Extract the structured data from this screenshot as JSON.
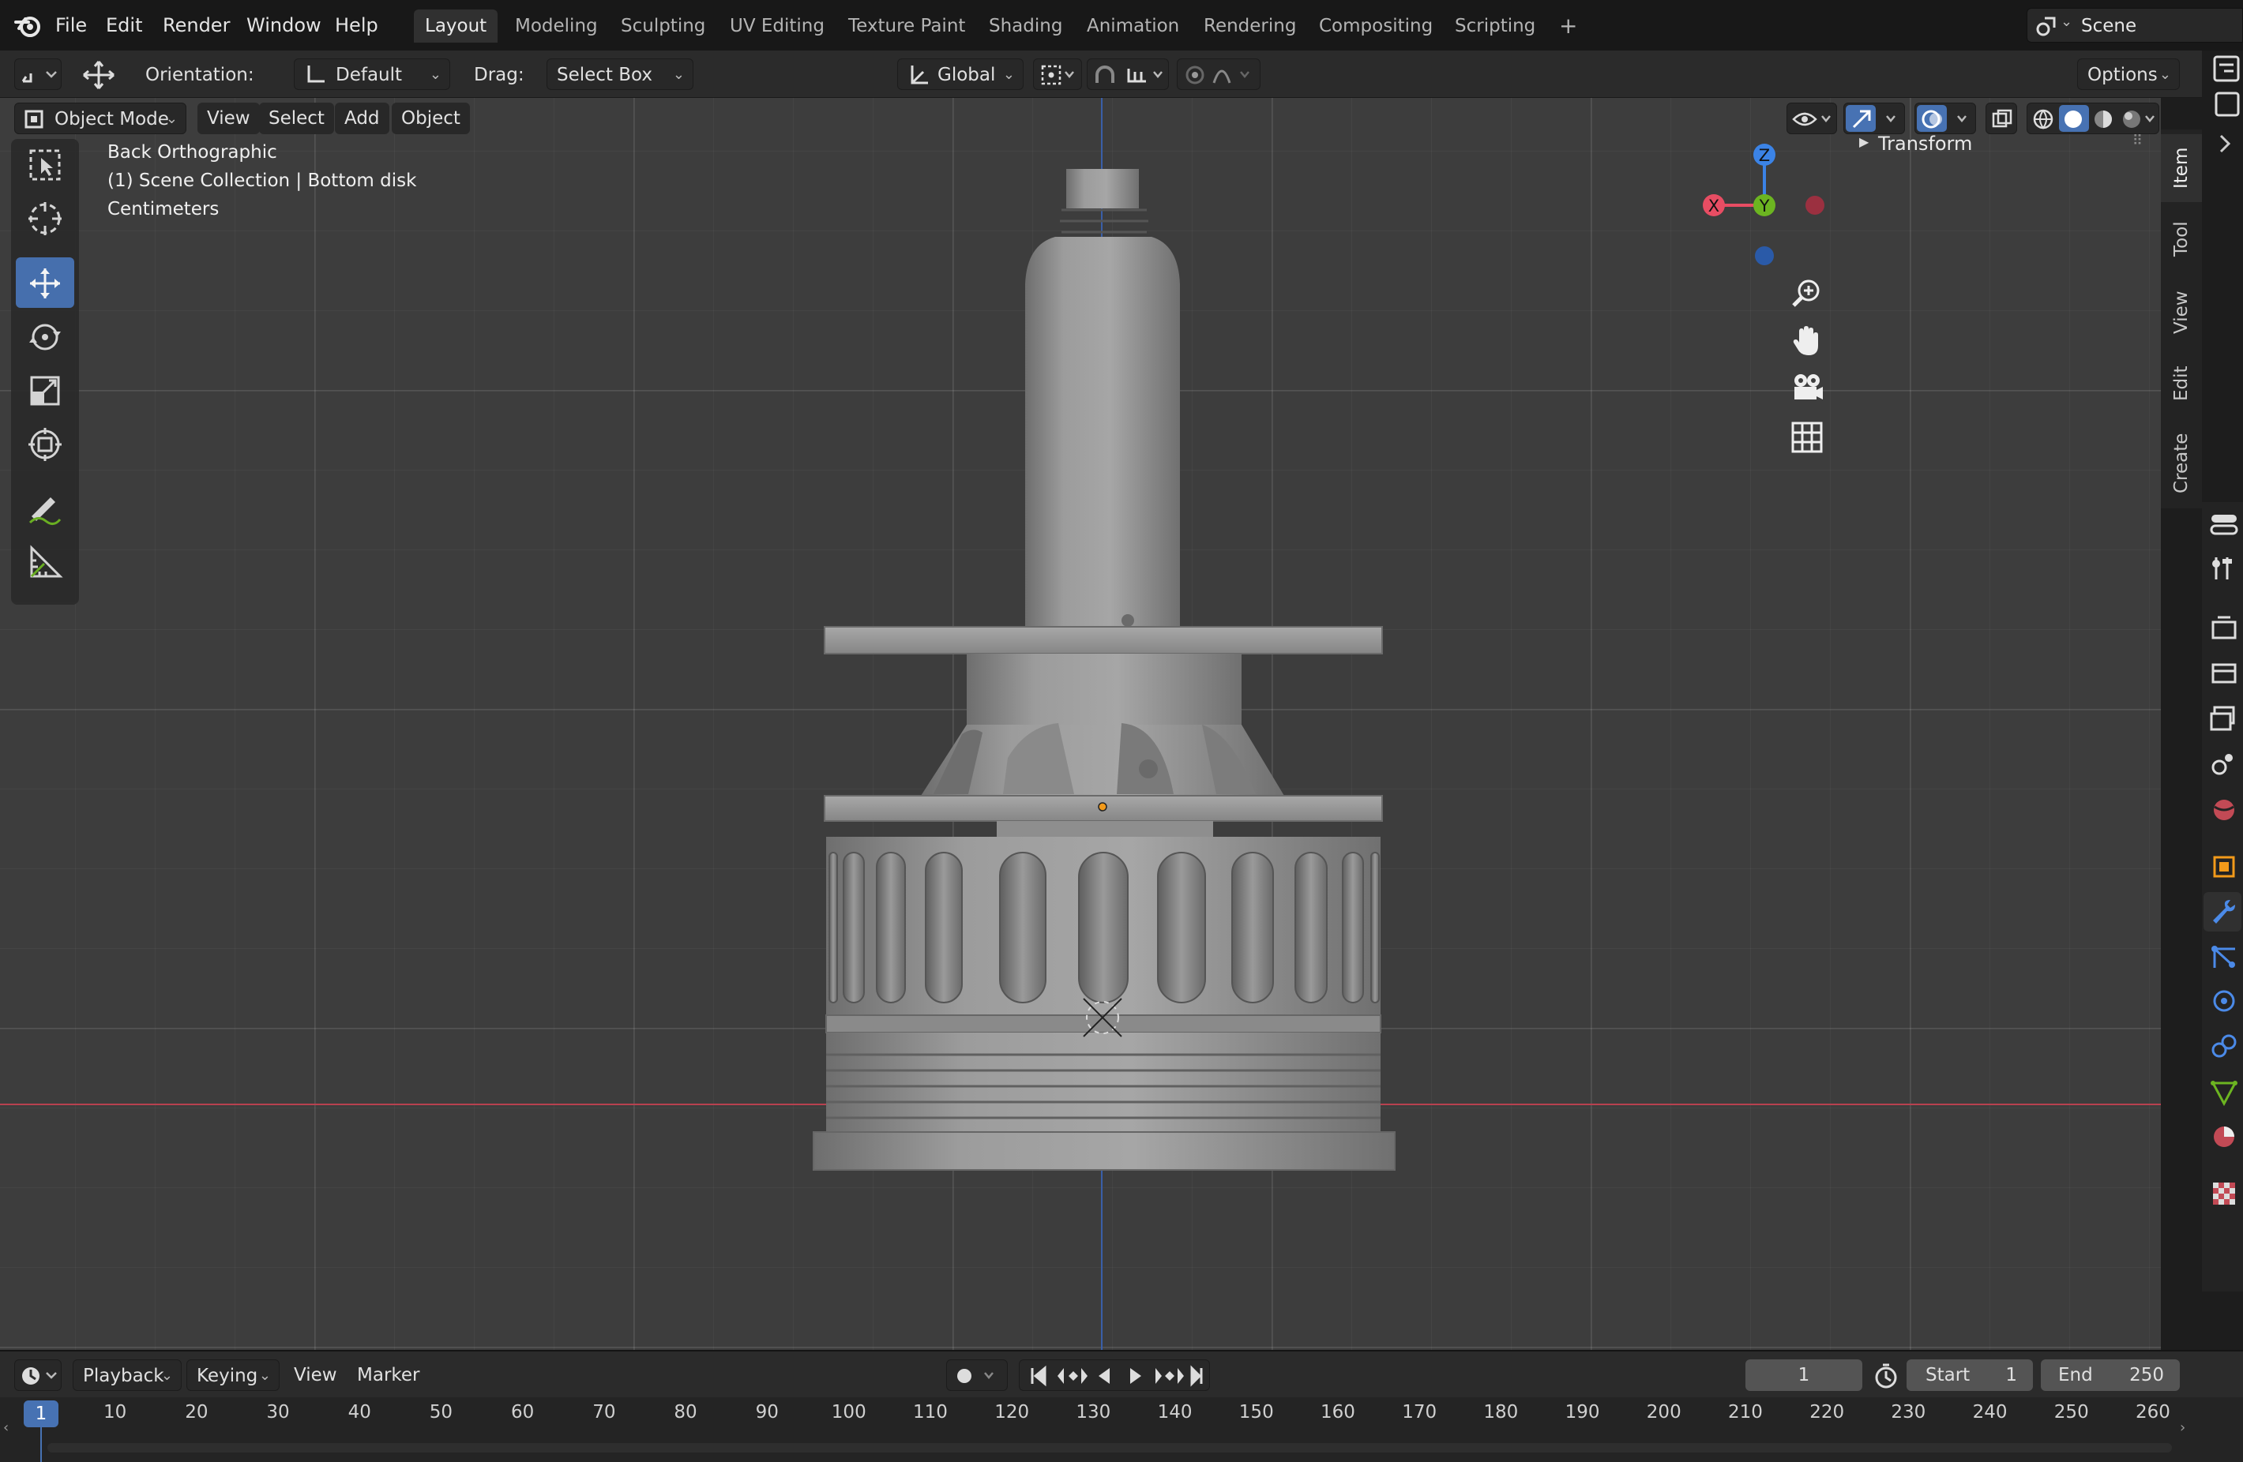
{
  "menubar": {
    "items": [
      "File",
      "Edit",
      "Render",
      "Window",
      "Help"
    ],
    "workspaces": [
      "Layout",
      "Modeling",
      "Sculpting",
      "UV Editing",
      "Texture Paint",
      "Shading",
      "Animation",
      "Rendering",
      "Compositing",
      "Scripting"
    ],
    "active_workspace": "Layout",
    "add_tab": "+",
    "scene_name": "Scene"
  },
  "tool_header": {
    "orientation_label": "Orientation:",
    "orientation_value": "Default",
    "drag_label": "Drag:",
    "drag_value": "Select Box",
    "transform_orientation": "Global",
    "options_label": "Options"
  },
  "viewport_header": {
    "mode": "Object Mode",
    "menus": [
      "View",
      "Select",
      "Add",
      "Object"
    ]
  },
  "viewport_info": {
    "view_name": "Back Orthographic",
    "collection": "(1) Scene Collection | Bottom disk",
    "units": "Centimeters"
  },
  "gizmo": {
    "z": "Z",
    "y": "Y",
    "x": "X"
  },
  "n_panel": {
    "section": "Transform",
    "tabs": [
      "Item",
      "Tool",
      "View",
      "Edit",
      "Create"
    ],
    "active_tab": "Item"
  },
  "timeline": {
    "menus": [
      "Playback",
      "Keying",
      "View",
      "Marker"
    ],
    "current_frame": "1",
    "start_label": "Start",
    "start_value": "1",
    "end_label": "End",
    "end_value": "250",
    "ticks": [
      "10",
      "20",
      "30",
      "40",
      "50",
      "60",
      "70",
      "80",
      "90",
      "100",
      "110",
      "120",
      "130",
      "140",
      "150",
      "160",
      "170",
      "180",
      "190",
      "200",
      "210",
      "220",
      "230",
      "240",
      "250",
      "260"
    ],
    "playhead": "1"
  },
  "colors": {
    "accent": "#4772b3",
    "x_axis": "#e84d63",
    "y_axis": "#6cb521",
    "z_axis": "#3b83e6",
    "origin": "#f29a1a"
  }
}
